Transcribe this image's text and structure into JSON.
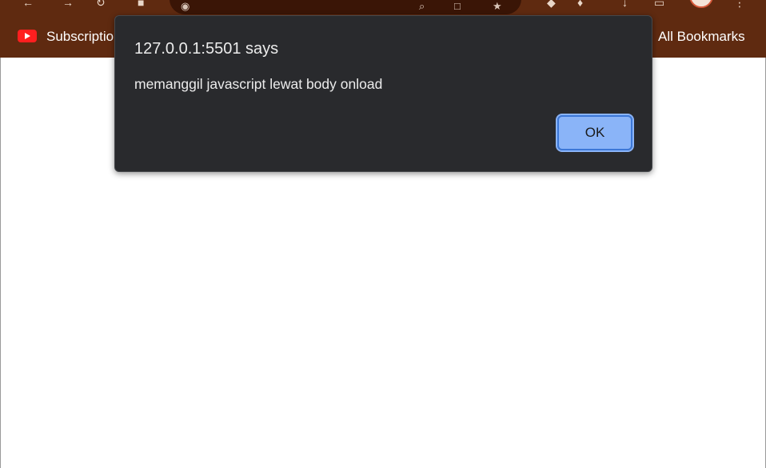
{
  "browser": {
    "bookmarks": [
      {
        "label": "Subscriptions",
        "icon": "youtube-icon"
      },
      {
        "label": "All Bookmarks"
      }
    ]
  },
  "alert": {
    "title": "127.0.0.1:5501 says",
    "message": "memanggil javascript lewat body onload",
    "ok_label": "OK"
  },
  "colors": {
    "chrome_bg": "#5f2a10",
    "dialog_bg": "#292a2d",
    "ok_button_bg": "#8ab4f8"
  }
}
